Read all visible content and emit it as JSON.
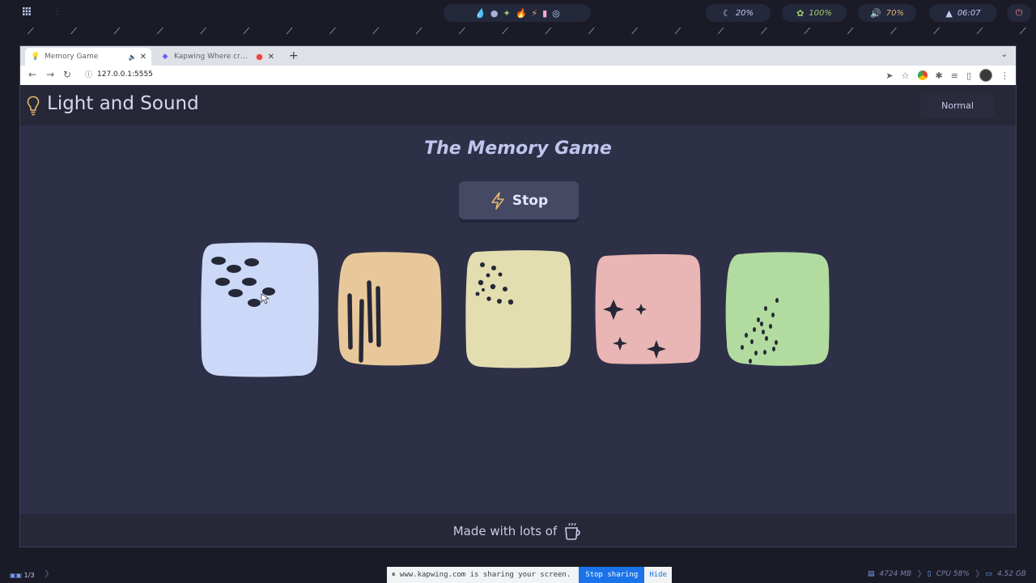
{
  "system_bar": {
    "launcher_icon": "apps-grid-icon",
    "tray_icons": [
      "water-drop-icon",
      "dot-icon",
      "puzzle-icon",
      "flame-icon",
      "bolt-icon",
      "ghost-icon",
      "lifebuoy-icon"
    ],
    "brightness": "20%",
    "battery": "100%",
    "volume": "70%",
    "clock": "06:07"
  },
  "browser": {
    "tabs": [
      {
        "title": "Memory Game",
        "active": true,
        "audio": true
      },
      {
        "title": "Kapwing   Where cr…",
        "active": false,
        "recording": true
      }
    ],
    "url": "127.0.0.1:5555"
  },
  "app": {
    "title": "Light and Sound",
    "mode_button": "Normal",
    "game_title": "The Memory Game",
    "stop_button": "Stop",
    "footer_text": "Made with lots of",
    "pad_colors": [
      "#cbd8f7",
      "#e8c89a",
      "#e2deb0",
      "#e9b5b5",
      "#b2dba0"
    ],
    "pad_icon_color": "#262838"
  },
  "bottom_bar": {
    "workspace": "1/3",
    "share_message": "⏸ www.kapwing.com is sharing your screen.",
    "stop_sharing": "Stop sharing",
    "hide": "Hide",
    "memory": "4724 MB",
    "cpu": "CPU 58%",
    "disk": "4.52 GB"
  }
}
